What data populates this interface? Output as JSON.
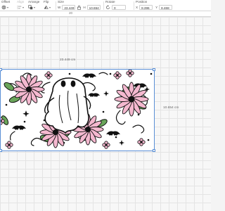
{
  "toolbar": {
    "offset_label": "Offset",
    "align_label": "Align",
    "arrange_label": "Arrange",
    "flip_label": "Flip",
    "size_label": "Size",
    "rotate_label": "Rotate",
    "position_label": "Position",
    "size": {
      "w_prefix": "W",
      "width": "23.449",
      "h_prefix": "H",
      "height": "10.654"
    },
    "rotate_value": "0",
    "position": {
      "x_prefix": "X",
      "x": "8.396",
      "y_prefix": "Y",
      "y": "8.468"
    }
  },
  "ruler": {
    "mark": "20"
  },
  "canvas": {
    "width_dimension": "23.449 cm",
    "height_dimension": "10.654 cm"
  },
  "colors": {
    "selection": "#5a8fd6",
    "flower_petal": "#f4b8cf",
    "leaf": "#6aa55a",
    "ink": "#111111"
  }
}
